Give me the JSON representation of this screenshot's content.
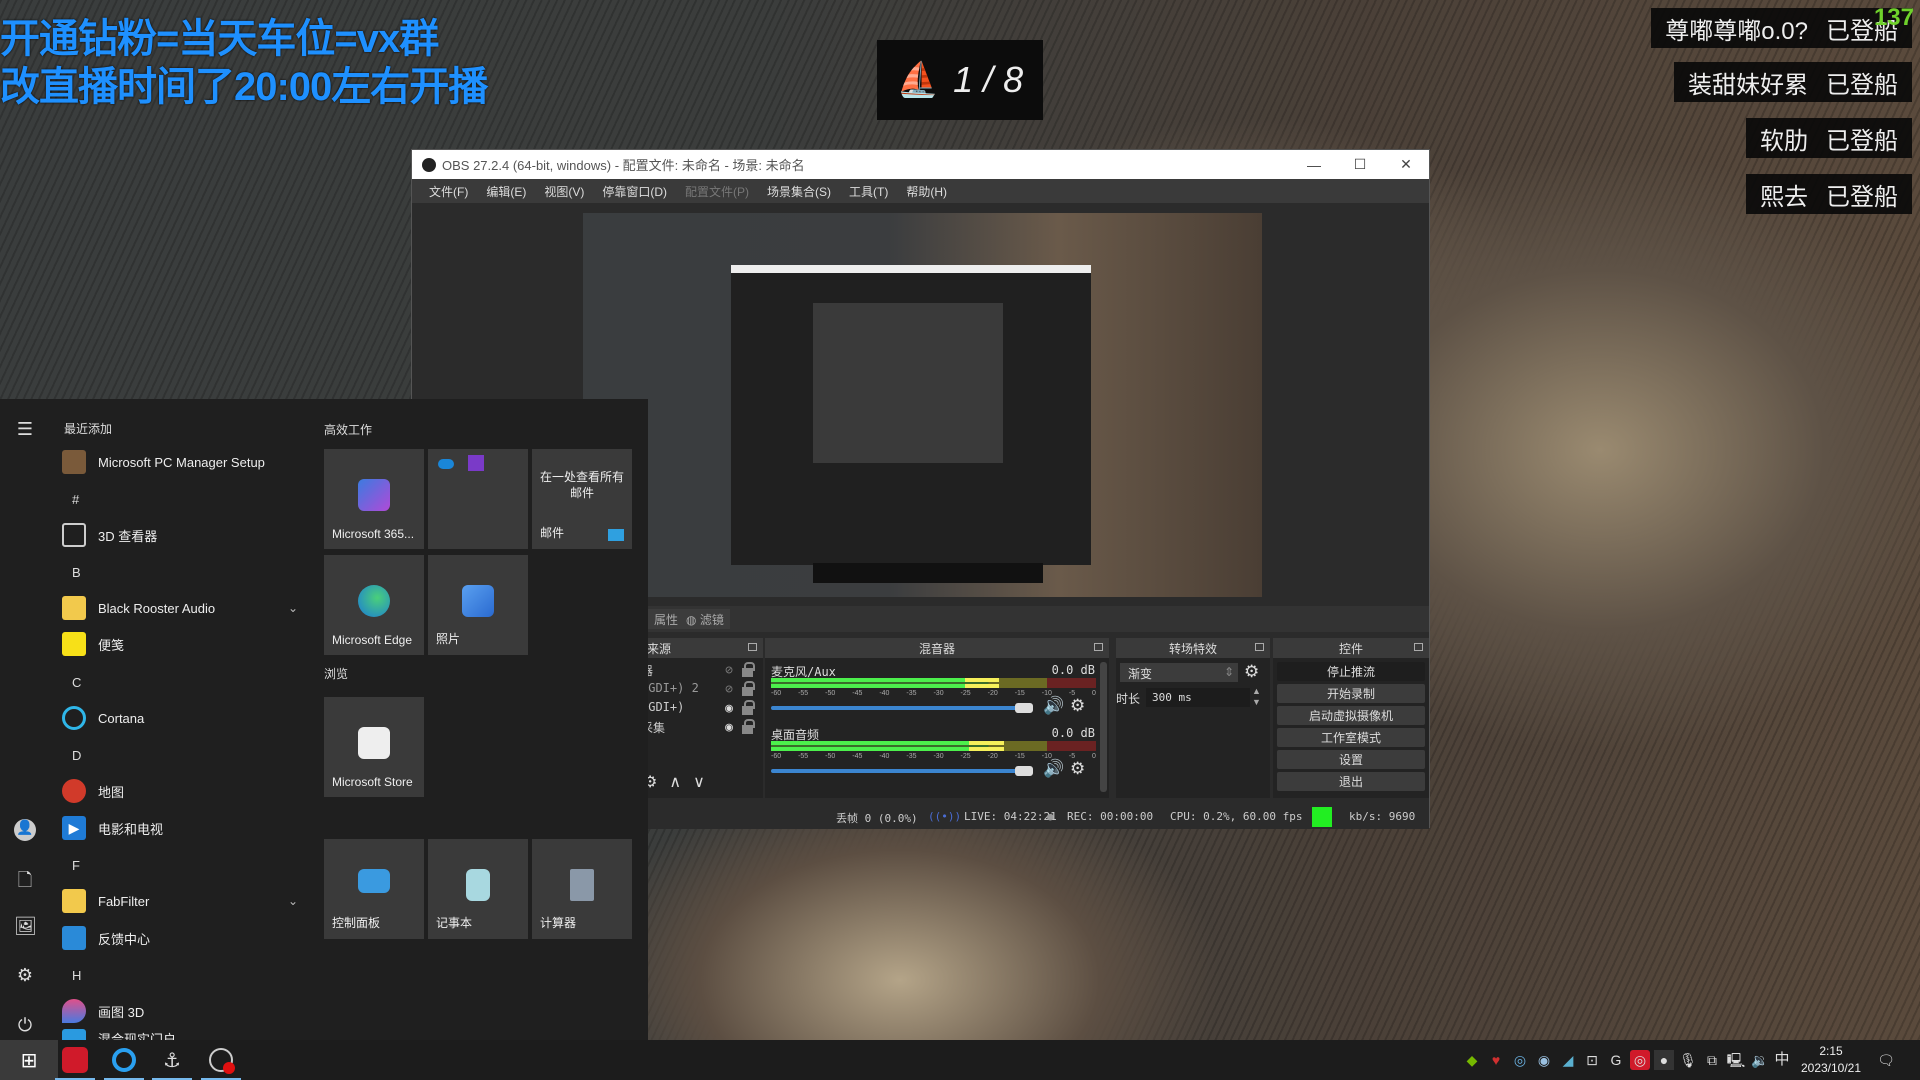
{
  "stream_overlay": {
    "announcement_line1": "开通钻粉=当天车位=vx群",
    "announcement_line2": "改直播时间了20:00左右开播",
    "ship_counter": "1 / 8",
    "viewer_count": "137",
    "boarding_feed": [
      {
        "user": "尊嘟尊嘟o.0?",
        "status": "已登船"
      },
      {
        "user": "装甜妹好累",
        "status": "已登船"
      },
      {
        "user": "软肋",
        "status": "已登船"
      },
      {
        "user": "熙去",
        "status": "已登船"
      }
    ]
  },
  "obs": {
    "title": "OBS 27.2.4 (64-bit, windows) - 配置文件: 未命名 - 场景: 未命名",
    "menu": [
      "文件(F)",
      "编辑(E)",
      "视图(V)",
      "停靠窗口(D)",
      "配置文件(P)",
      "场景集合(S)",
      "工具(T)",
      "帮助(H)"
    ],
    "toolbar": {
      "properties": "属性",
      "filters": "滤镜"
    },
    "sources": {
      "title": "来源",
      "items": [
        {
          "name": "器",
          "visible": false
        },
        {
          "name": "(GDI+) 2",
          "visible": false
        },
        {
          "name": "(GDI+)",
          "visible": true
        },
        {
          "name": "采集",
          "visible": true
        }
      ]
    },
    "mixer": {
      "title": "混音器",
      "ticks": [
        "-60",
        "-55",
        "-50",
        "-45",
        "-40",
        "-35",
        "-30",
        "-25",
        "-20",
        "-15",
        "-10",
        "-5",
        "0"
      ],
      "channels": [
        {
          "name": "麦克风/Aux",
          "db": "0.0 dB",
          "level_db": -18,
          "volume": 1.0
        },
        {
          "name": "桌面音频",
          "db": "0.0 dB",
          "level_db": -17,
          "volume": 1.0
        }
      ]
    },
    "transitions": {
      "title": "转场特效",
      "selected": "渐变",
      "duration_label": "时长",
      "duration": "300 ms"
    },
    "controls": {
      "title": "控件",
      "buttons": [
        "停止推流",
        "开始录制",
        "启动虚拟摄像机",
        "工作室模式",
        "设置",
        "退出"
      ]
    },
    "status": {
      "dropped": "丢帧 0 (0.0%)",
      "live": "LIVE: 04:22:21",
      "rec": "REC: 00:00:00",
      "cpu": "CPU: 0.2%, 60.00 fps",
      "kbps": "kb/s: 9690",
      "health_color": "#22ee22"
    }
  },
  "start_menu": {
    "recent_header": "最近添加",
    "apps": [
      {
        "type": "app",
        "label": "Microsoft PC Manager Setup",
        "icon": "package-icon"
      },
      {
        "type": "letter",
        "label": "#"
      },
      {
        "type": "app",
        "label": "3D 查看器",
        "icon": "cube-icon"
      },
      {
        "type": "letter",
        "label": "B"
      },
      {
        "type": "folder",
        "label": "Black Rooster Audio",
        "icon": "folder-icon"
      },
      {
        "type": "app",
        "label": "便笺",
        "icon": "sticky-notes-icon"
      },
      {
        "type": "letter",
        "label": "C"
      },
      {
        "type": "app",
        "label": "Cortana",
        "icon": "cortana-icon"
      },
      {
        "type": "letter",
        "label": "D"
      },
      {
        "type": "app",
        "label": "地图",
        "icon": "maps-icon"
      },
      {
        "type": "app",
        "label": "电影和电视",
        "icon": "movies-icon"
      },
      {
        "type": "letter",
        "label": "F"
      },
      {
        "type": "folder",
        "label": "FabFilter",
        "icon": "folder-icon"
      },
      {
        "type": "app",
        "label": "反馈中心",
        "icon": "feedback-icon"
      },
      {
        "type": "letter",
        "label": "H"
      },
      {
        "type": "app",
        "label": "画图 3D",
        "icon": "paint3d-icon"
      },
      {
        "type": "app",
        "label": "混合现实门户",
        "icon": "mixed-reality-icon"
      }
    ],
    "groups": {
      "productivity": "高效工作",
      "browse": "浏览"
    },
    "tiles": {
      "m365": "Microsoft 365...",
      "mail_promo": "在一处查看所有邮件",
      "mail": "邮件",
      "edge": "Microsoft Edge",
      "photos": "照片",
      "store": "Microsoft Store",
      "control_panel": "控制面板",
      "notepad": "记事本",
      "calculator": "计算器"
    }
  },
  "taskbar": {
    "time": "2:15",
    "date": "2023/10/21",
    "ime": "中"
  }
}
